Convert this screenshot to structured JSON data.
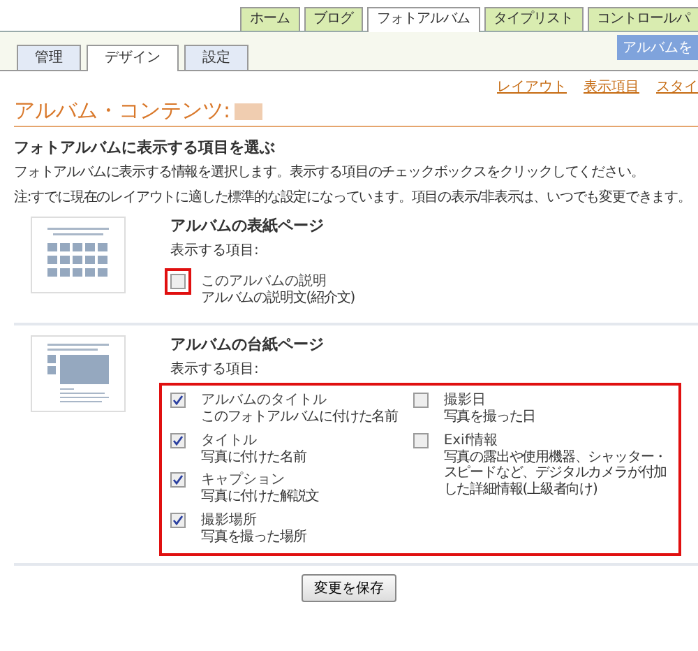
{
  "top_tabs": [
    {
      "label": "ホーム",
      "selected": false
    },
    {
      "label": "ブログ",
      "selected": false
    },
    {
      "label": "フォトアルバム",
      "selected": true
    },
    {
      "label": "タイプリスト",
      "selected": false
    },
    {
      "label": "コントロールパ",
      "selected": false
    }
  ],
  "sub_tabs": [
    {
      "label": "管理",
      "selected": false
    },
    {
      "label": "デザイン",
      "selected": true
    },
    {
      "label": "設定",
      "selected": false
    }
  ],
  "album_button": "アルバムを",
  "view_links": [
    "レイアウト",
    "表示項目",
    "スタイ"
  ],
  "page_title": "アルバム・コンテンツ:",
  "heading": "フォトアルバムに表示する項目を選ぶ",
  "intro": "フォトアルバムに表示する情報を選択します。表示する項目のチェックボックスをクリックしてください。",
  "note": "注:すでに現在のレイアウトに適した標準的な設定になっています。項目の表示/非表示は、いつでも変更できます。",
  "sections": [
    {
      "kind": "cover",
      "title": "アルバムの表紙ページ",
      "items_label": "表示する項目:",
      "items_highlighted": false,
      "columns": [
        [
          {
            "label": "このアルバムの説明",
            "description": "アルバムの説明文(紹介文)",
            "checked": false,
            "highlighted": true
          }
        ]
      ]
    },
    {
      "kind": "page",
      "title": "アルバムの台紙ページ",
      "items_label": "表示する項目:",
      "items_highlighted": true,
      "columns": [
        [
          {
            "label": "アルバムのタイトル",
            "description": "このフォトアルバムに付けた名前",
            "checked": true,
            "highlighted": false
          },
          {
            "label": "タイトル",
            "description": "写真に付けた名前",
            "checked": true,
            "highlighted": false
          },
          {
            "label": "キャプション",
            "description": "写真に付けた解説文",
            "checked": true,
            "highlighted": false
          },
          {
            "label": "撮影場所",
            "description": "写真を撮った場所",
            "checked": true,
            "highlighted": false
          }
        ],
        [
          {
            "label": "撮影日",
            "description": "写真を撮った日",
            "checked": false,
            "highlighted": false
          },
          {
            "label": "Exif情報",
            "description": "写真の露出や使用機器、シャッター・スピードなど、デジタルカメラが付加した詳細情報(上級者向け)",
            "checked": false,
            "highlighted": false
          }
        ]
      ]
    }
  ],
  "save_button": "変更を保存"
}
